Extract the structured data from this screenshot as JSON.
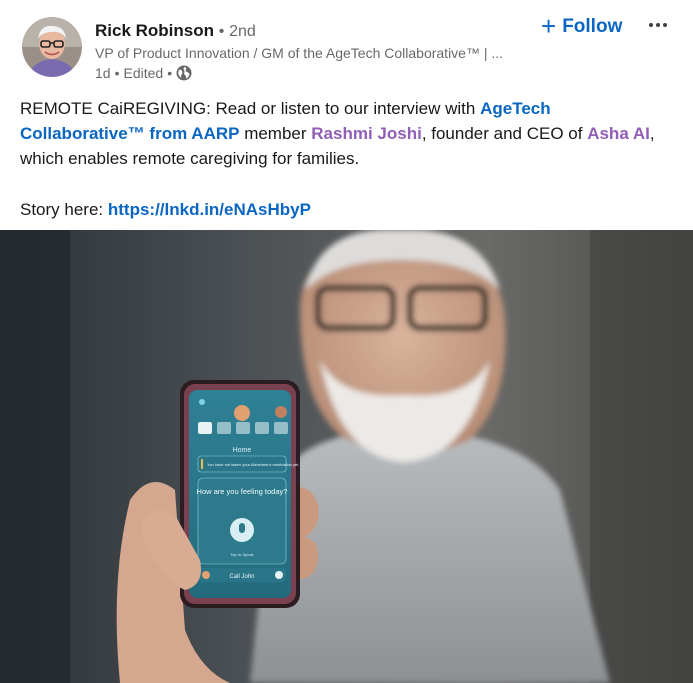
{
  "author": {
    "name": "Rick Robinson",
    "separator": "•",
    "degree": "2nd",
    "headline": "VP of Product Innovation / GM of the AgeTech Collaborative™ | ...",
    "time": "1d",
    "edited": "Edited",
    "visibility_icon": "globe-icon"
  },
  "actions": {
    "follow_plus": "+",
    "follow_label": "Follow",
    "more_icon": "ellipsis-icon"
  },
  "post": {
    "p1_a": "REMOTE CaiREGIVING: Read or listen to our interview with ",
    "p1_link1": "AgeTech Collaborative™ from AARP",
    "p1_b": " member ",
    "p1_link2": "Rashmi Joshi",
    "p1_c": ", founder and CEO of ",
    "p1_link3": "Asha AI",
    "p1_d": ", which enables remote caregiving for families.",
    "story_label": "Story here: ",
    "story_link": "https://lnkd.in/eNAsHbyP"
  },
  "image": {
    "phone": {
      "tab_title": "Home",
      "notice": "You have not taken your Alzheimer's medication yet.",
      "prompt": "How are you feeling today?",
      "tap_hint": "Tap to Speak",
      "call_label": "Call John"
    }
  },
  "colors": {
    "link": "#0a66c2",
    "mention": "#915eb8",
    "app_teal": "#2f7f92"
  }
}
